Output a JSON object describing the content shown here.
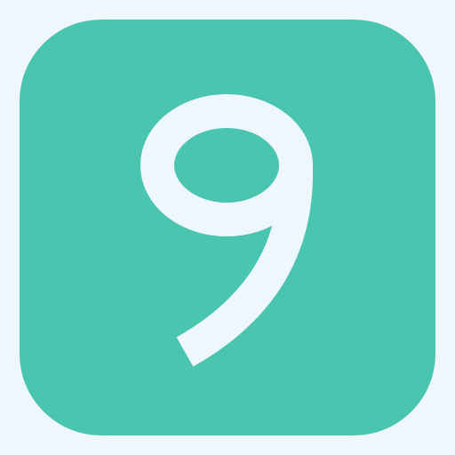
{
  "icon": {
    "name": "number-nine-icon",
    "digit": "9",
    "tile_color": "#4ac5b0",
    "glyph_color": "#eef7fd",
    "background_color": "#eef7fd"
  }
}
